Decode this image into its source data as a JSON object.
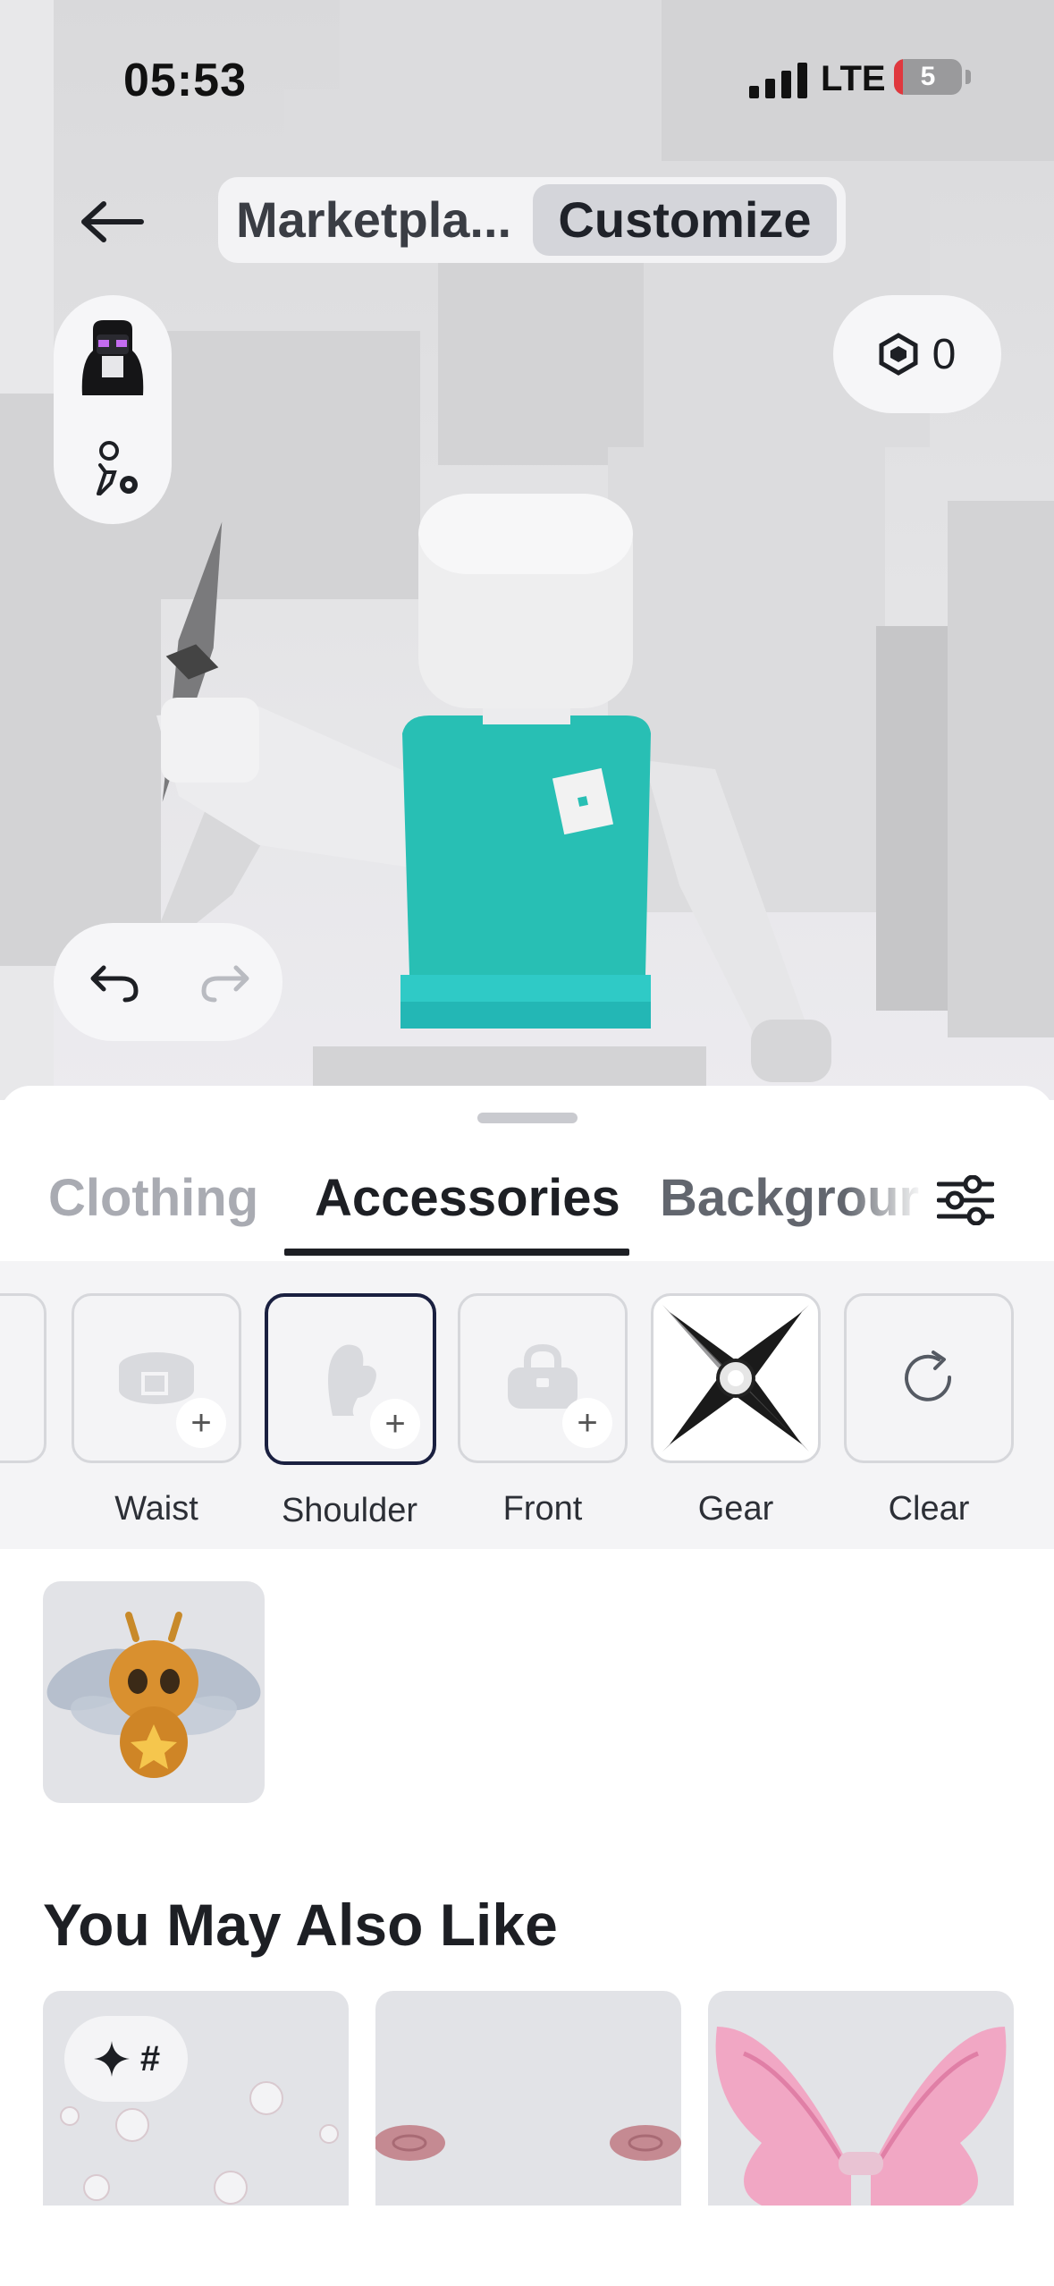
{
  "status_bar": {
    "time": "05:53",
    "network": "LTE",
    "battery": "5"
  },
  "header": {
    "back_icon": "arrow-left-icon",
    "segments": [
      {
        "label": "Marketpla...",
        "selected": false
      },
      {
        "label": "Customize",
        "selected": true
      }
    ]
  },
  "side_controls": {
    "avatar_icon": "avatar-thumbnail-icon",
    "settings_icon": "avatar-settings-icon"
  },
  "currency": {
    "icon": "robux-icon",
    "amount": "0"
  },
  "history": {
    "undo_icon": "undo-icon",
    "redo_icon": "redo-icon",
    "redo_enabled": false
  },
  "tabs": [
    {
      "label": "Clothing",
      "active": false
    },
    {
      "label": "Accessories",
      "active": true
    },
    {
      "label": "Backgrour",
      "active": false
    }
  ],
  "filter_icon": "sliders-icon",
  "categories": [
    {
      "label": "Waist",
      "icon": "belt-icon",
      "selected": false
    },
    {
      "label": "Shoulder",
      "icon": "shoulder-icon",
      "selected": true
    },
    {
      "label": "Front",
      "icon": "bag-icon",
      "selected": false
    },
    {
      "label": "Gear",
      "icon": "shuriken-icon",
      "selected": false
    },
    {
      "label": "Clear",
      "icon": "refresh-icon",
      "selected": false
    }
  ],
  "equipped_items": [
    {
      "name": "bee-pet-shoulder-item"
    }
  ],
  "recommendations": {
    "title": "You May Also Like",
    "chip_text": "#",
    "chip_icon": "sparkle-icon"
  },
  "colors": {
    "accent_dark": "#1a2040",
    "torso": "#28bfb4"
  }
}
